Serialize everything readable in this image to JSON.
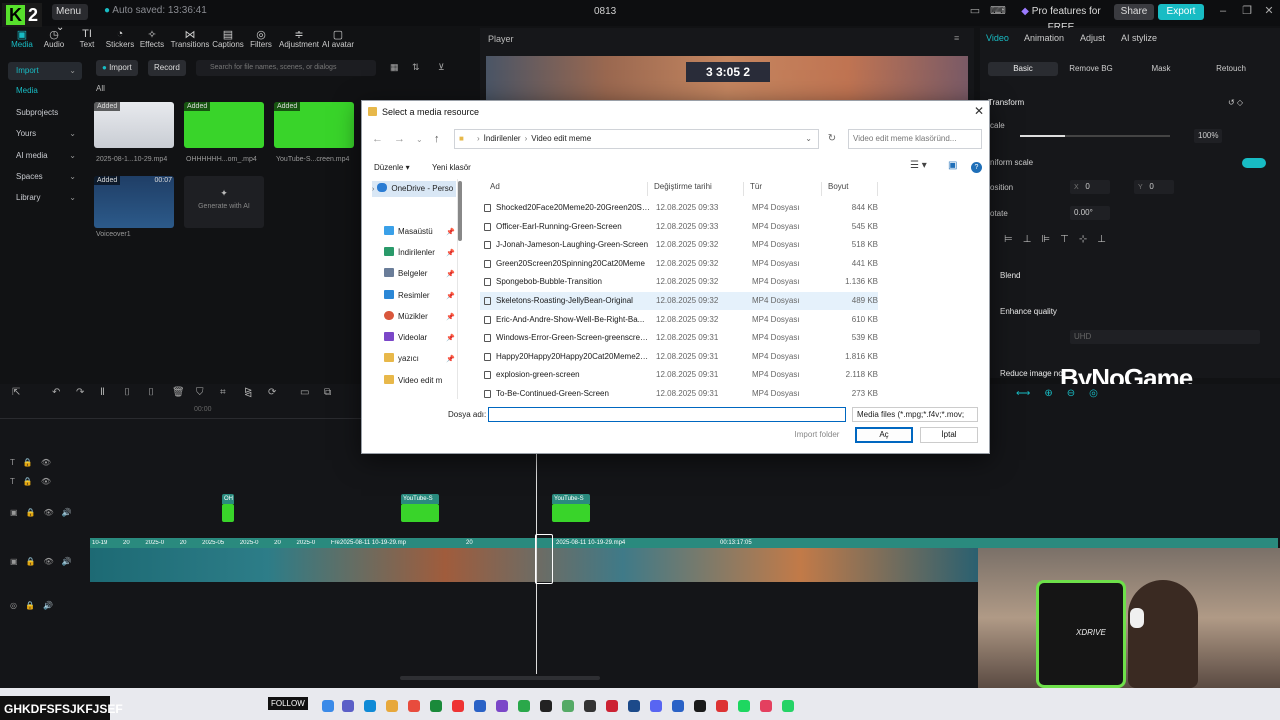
{
  "topbar": {
    "logo_text": "2",
    "menu_label": "Menu ⌄",
    "autosave": "Auto saved: 13:36:41",
    "project_name": "0813",
    "pro_label": "Pro features for FREE",
    "share_label": "Share",
    "export_label": "Export",
    "accent_color": "#18bcc4"
  },
  "tools": [
    {
      "label": "Media",
      "icon": "media-icon"
    },
    {
      "label": "Audio",
      "icon": "audio-icon"
    },
    {
      "label": "Text",
      "icon": "text-icon"
    },
    {
      "label": "Stickers",
      "icon": "stickers-icon"
    },
    {
      "label": "Effects",
      "icon": "effects-icon"
    },
    {
      "label": "Transitions",
      "icon": "transitions-icon"
    },
    {
      "label": "Captions",
      "icon": "captions-icon"
    },
    {
      "label": "Filters",
      "icon": "filters-icon"
    },
    {
      "label": "Adjustment",
      "icon": "adjustment-icon"
    },
    {
      "label": "AI avatar",
      "icon": "ai-avatar-icon"
    }
  ],
  "sidebar": {
    "items": [
      "Import",
      "Media",
      "Subprojects",
      "Yours",
      "AI media",
      "Spaces",
      "Library"
    ]
  },
  "media": {
    "import_label": "Import",
    "record_label": "Record",
    "search_placeholder": "Search for file names, scenes, or dialogs",
    "filter_label": "All",
    "added_badge": "Added",
    "thumbs": [
      {
        "label": "2025-08-1...10-29.mp4"
      },
      {
        "label": "OHHHHHH...om_.mp4"
      },
      {
        "label": "YouTube-S...creen.mp4"
      },
      {
        "label": "Voiceover1",
        "duration": "00:07"
      }
    ],
    "generate_label": "Generate with AI"
  },
  "player": {
    "title": "Player",
    "score_left": "3",
    "score_time": "3:05",
    "score_right": "2"
  },
  "props": {
    "tabs": [
      "Video",
      "Animation",
      "Adjust",
      "AI stylize"
    ],
    "subtabs": [
      "Basic",
      "Remove BG",
      "Mask",
      "Retouch"
    ],
    "transform_label": "Transform",
    "scale_label": "cale",
    "scale_value": "100%",
    "uniform_label": "niform scale",
    "position_label": "osition",
    "pos_x_label": "X",
    "pos_x": "0",
    "pos_y_label": "Y",
    "pos_y": "0",
    "rotate_label": "otate",
    "rotate_value": "0.00°",
    "blend_label": "Blend",
    "enhance_label": "Enhance quality",
    "uhd_label": "UHD",
    "reduce_label": "Reduce image no",
    "watermark": "ByNoGame"
  },
  "timeline": {
    "ruler_label": "00:00",
    "clip1": "OH",
    "clip2": "YouTube-S",
    "clip3": "YouTube-S",
    "main_clips": [
      "20",
      "2025-08-11 10-19-29.mp",
      "2025-08-11 10-19-29.mp4",
      "00:13:17:05"
    ],
    "main_tags": [
      "10-19",
      "20",
      "2025-0",
      "20",
      "2025-05",
      "2025-0",
      "20",
      "2025-0",
      "Fre"
    ]
  },
  "webcam": {
    "chair_label": "XDRIVE"
  },
  "taskbar": {
    "ticker": "GHKDFSFSJKFJSEF",
    "follow": "FOLLOW"
  },
  "dialog": {
    "title": "Select a media resource",
    "path": [
      "İndirilenler",
      "Video edit meme"
    ],
    "search_placeholder": "Video edit meme klasöründ...",
    "organize_label": "Düzenle ▾",
    "new_folder_label": "Yeni klasör",
    "nav": [
      {
        "label": "OneDrive - Perso",
        "icon": "onedrive-icon",
        "color": "#2b7cd3"
      },
      {
        "label": "Masaüstü",
        "icon": "desktop-icon",
        "color": "#3aa0e8"
      },
      {
        "label": "İndirilenler",
        "icon": "download-icon",
        "color": "#2a9a6a"
      },
      {
        "label": "Belgeler",
        "icon": "documents-icon",
        "color": "#6a7d99"
      },
      {
        "label": "Resimler",
        "icon": "pictures-icon",
        "color": "#2b87d6"
      },
      {
        "label": "Müzikler",
        "icon": "music-icon",
        "color": "#d9573c"
      },
      {
        "label": "Videolar",
        "icon": "videos-icon",
        "color": "#7b47c8"
      },
      {
        "label": "yazıcı",
        "icon": "folder-icon",
        "color": "#e8b84a"
      },
      {
        "label": "Video edit m",
        "icon": "folder-icon",
        "color": "#e8b84a"
      }
    ],
    "columns": [
      "Ad",
      "Değiştirme tarihi",
      "Tür",
      "Boyut"
    ],
    "files": [
      {
        "name": "Shocked20Face20Meme20-20Green20Scr...",
        "date": "12.08.2025 09:33",
        "type": "MP4 Dosyası",
        "size": "844 KB"
      },
      {
        "name": "Officer-Earl-Running-Green-Screen",
        "date": "12.08.2025 09:33",
        "type": "MP4 Dosyası",
        "size": "545 KB"
      },
      {
        "name": "J-Jonah-Jameson-Laughing-Green-Screen",
        "date": "12.08.2025 09:32",
        "type": "MP4 Dosyası",
        "size": "518 KB"
      },
      {
        "name": "Green20Screen20Spinning20Cat20Meme",
        "date": "12.08.2025 09:32",
        "type": "MP4 Dosyası",
        "size": "441 KB"
      },
      {
        "name": "Spongebob-Bubble-Transition",
        "date": "12.08.2025 09:32",
        "type": "MP4 Dosyası",
        "size": "1.136 KB"
      },
      {
        "name": "Skeletons-Roasting-JellyBean-Original",
        "date": "12.08.2025 09:32",
        "type": "MP4 Dosyası",
        "size": "489 KB"
      },
      {
        "name": "Eric-And-Andre-Show-Well-Be-Right-Ba...",
        "date": "12.08.2025 09:32",
        "type": "MP4 Dosyası",
        "size": "610 KB"
      },
      {
        "name": "Windows-Error-Green-Screen-greenscree...",
        "date": "12.08.2025 09:31",
        "type": "MP4 Dosyası",
        "size": "539 KB"
      },
      {
        "name": "Happy20Happy20Happy20Cat20Meme20...",
        "date": "12.08.2025 09:31",
        "type": "MP4 Dosyası",
        "size": "1.816 KB"
      },
      {
        "name": "explosion-green-screen",
        "date": "12.08.2025 09:31",
        "type": "MP4 Dosyası",
        "size": "2.118 KB"
      },
      {
        "name": "To-Be-Continued-Green-Screen",
        "date": "12.08.2025 09:31",
        "type": "MP4 Dosyası",
        "size": "273 KB"
      }
    ],
    "filename_label": "Dosya adı:",
    "filename_value": "",
    "filetype": "Media files (*.mpg;*.f4v;*.mov;",
    "import_folder_label": "Import folder",
    "open_label": "Aç",
    "cancel_label": "İptal"
  }
}
